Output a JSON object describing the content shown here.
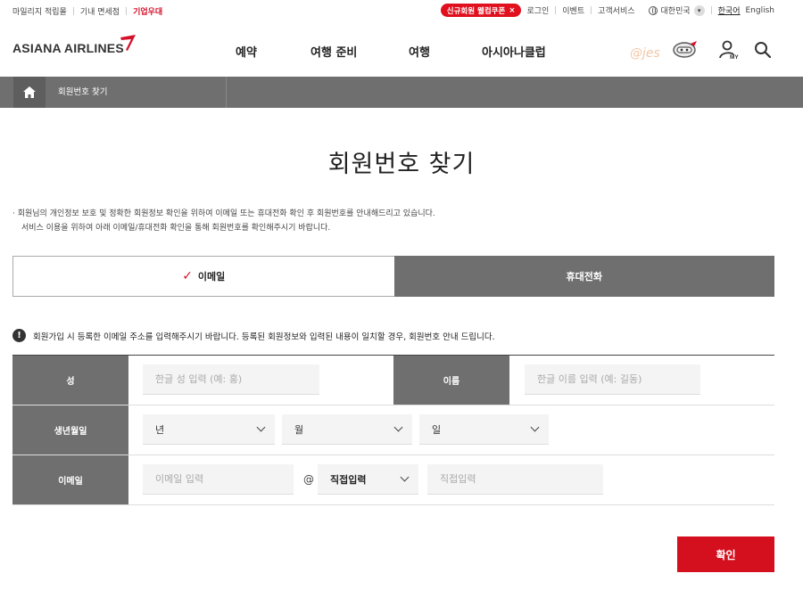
{
  "util": {
    "links_left": [
      "마일리지 적립몰",
      "기내 면세점",
      "기업우대"
    ],
    "coupon": "신규회원 웰컴쿠폰",
    "coupon_close": "×",
    "login": "로그인",
    "event": "이벤트",
    "support": "고객서비스",
    "region": "대한민국",
    "lang_ko": "한국어",
    "lang_en": "English"
  },
  "header": {
    "logo": "ASIANA AIRLINES",
    "nav": [
      "예약",
      "여행 준비",
      "여행",
      "아시아나클럽"
    ],
    "watermark": "@jes",
    "my_label": "MY"
  },
  "breadcrumb": {
    "current": "회원번호 찾기"
  },
  "page": {
    "title": "회원번호 찾기",
    "intro_line1": "· 회원님의 개인정보 보호 및 정확한 회원정보 확인을 위하여 이메일 또는 휴대전화 확인 후 회원번호를 안내해드리고 있습니다.",
    "intro_line2": "서비스 이용을 위하여 아래 이메일/휴대전화 확인을 통해 회원번호를 확인해주시기 바랍니다."
  },
  "tabs": {
    "email": "이메일",
    "phone": "휴대전화",
    "active": "email"
  },
  "notice": {
    "icon": "!",
    "text": "회원가입 시 등록한 이메일 주소를 입력해주시기 바랍니다. 등록된 회원정보와 입력된 내용이 일치할 경우, 회원번호 안내 드립니다."
  },
  "form": {
    "surname_label": "성",
    "surname_placeholder": "한글 성 입력 (예: 홍)",
    "given_label": "이름",
    "given_placeholder": "한글 이름 입력 (예: 길동)",
    "birth_label": "생년월일",
    "year": "년",
    "month": "월",
    "day": "일",
    "email_label": "이메일",
    "email_placeholder": "이메일 입력",
    "at": "@",
    "domain_select": "직접입력",
    "domain_placeholder": "직접입력"
  },
  "confirm_label": "확인",
  "colors": {
    "accent": "#d4101e",
    "gray": "#6f6f6f"
  }
}
